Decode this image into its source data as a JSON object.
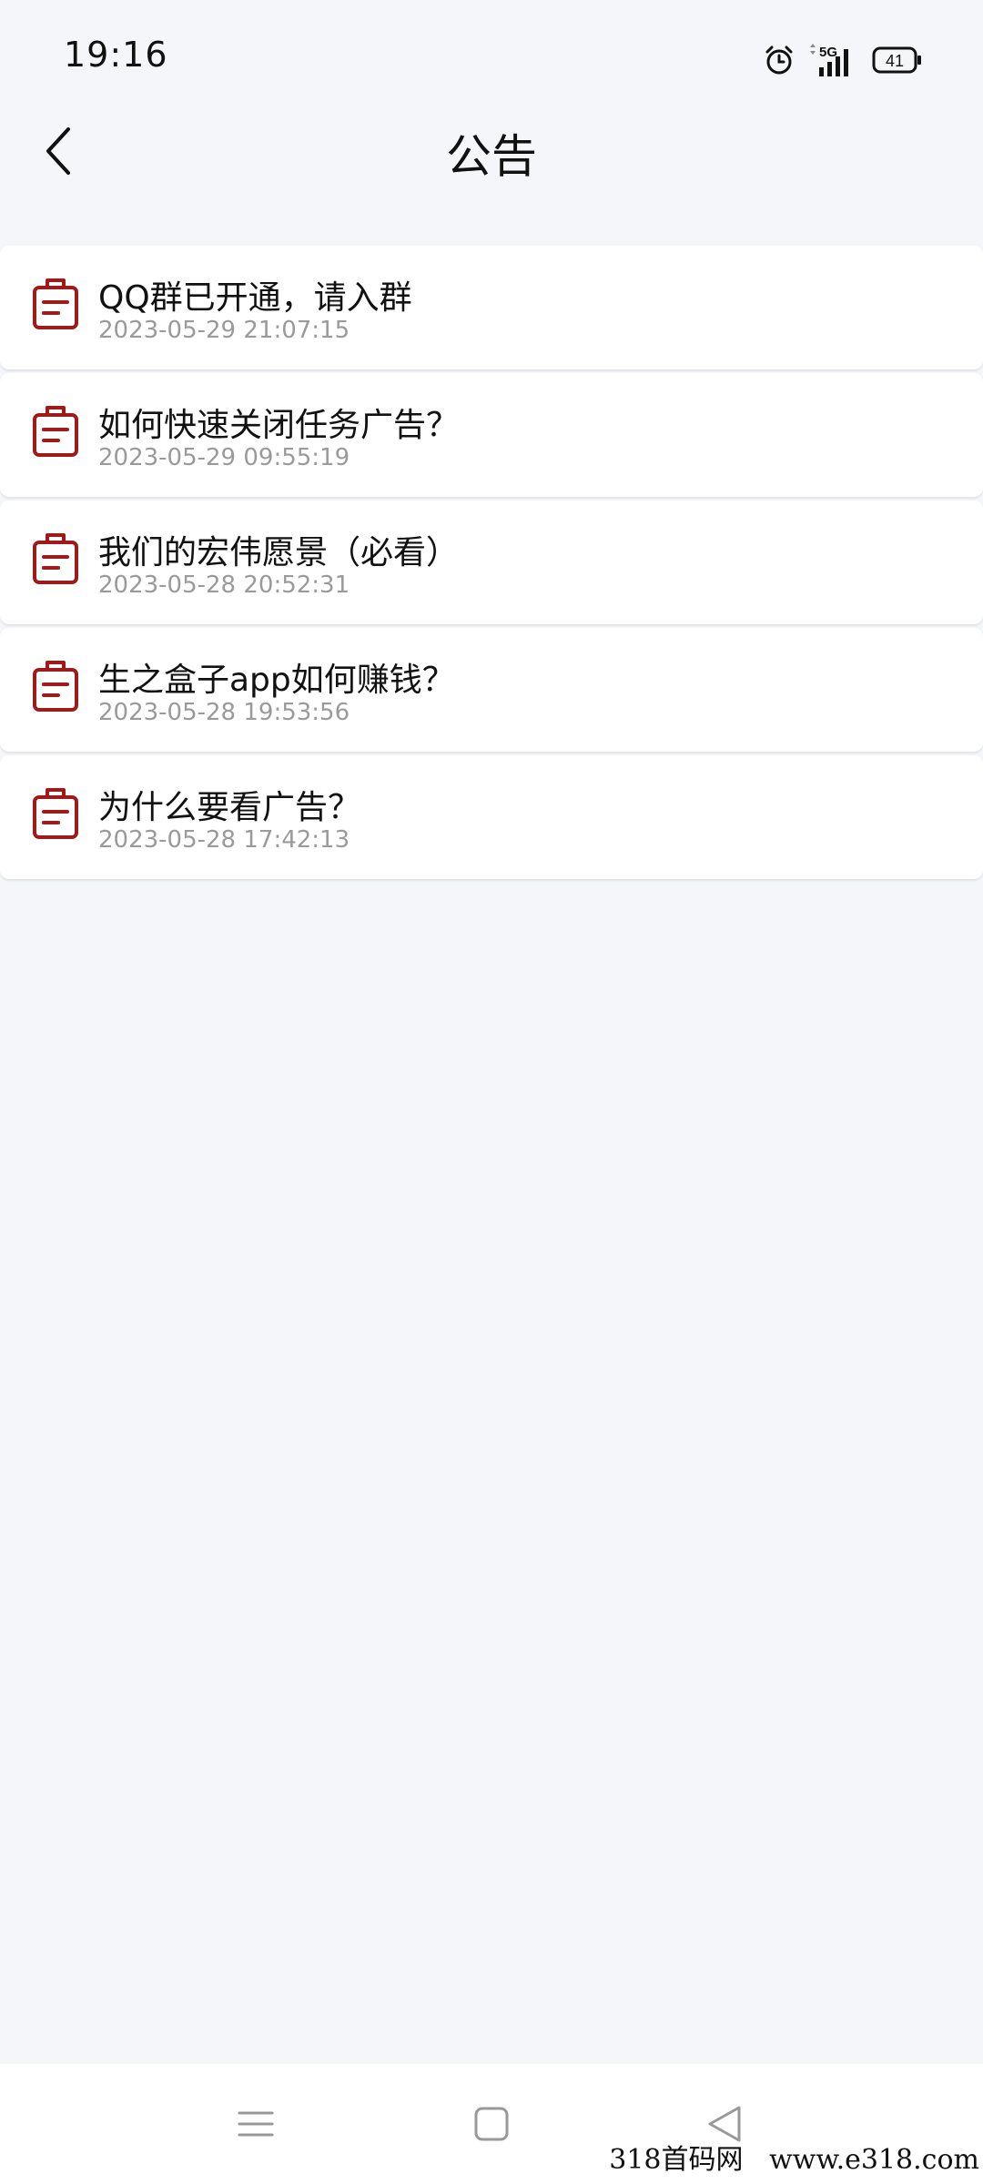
{
  "status_bar": {
    "time": "19:16",
    "network": "5G",
    "battery": "41"
  },
  "header": {
    "title": "公告"
  },
  "notices": [
    {
      "title": "QQ群已开通，请入群",
      "time": "2023-05-29 21:07:15"
    },
    {
      "title": "如何快速关闭任务广告？",
      "time": "2023-05-29 09:55:19"
    },
    {
      "title": "我们的宏伟愿景（必看）",
      "time": "2023-05-28 20:52:31"
    },
    {
      "title": "生之盒子app如何赚钱？",
      "time": "2023-05-28 19:53:56"
    },
    {
      "title": "为什么要看广告？",
      "time": "2023-05-28 17:42:13"
    }
  ],
  "colors": {
    "icon_accent": "#a11a1a",
    "background": "#f5f6fa",
    "secondary_text": "#9a9a9a"
  },
  "icons": {
    "back": "chevron-left-icon",
    "notice": "clipboard-icon",
    "nav_menu": "menu-icon",
    "nav_home": "square-icon",
    "nav_back": "triangle-back-icon"
  },
  "watermark": "318首码网   www.e318.com"
}
